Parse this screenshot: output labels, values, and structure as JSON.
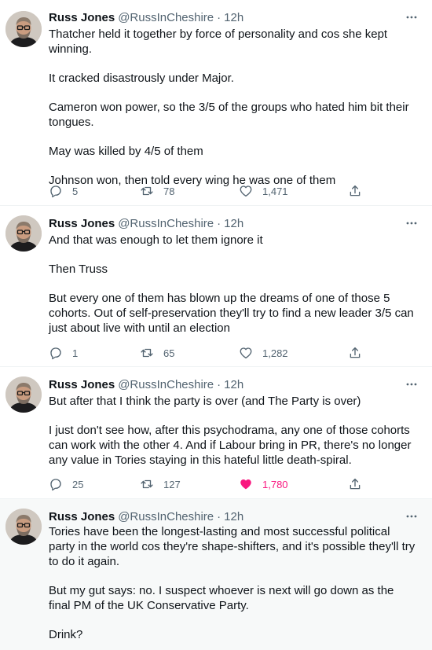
{
  "colors": {
    "like_active": "#f91880",
    "secondary_text": "#536471",
    "divider": "#eff3f4",
    "highlight_bg": "#f7f9f9"
  },
  "icons": [
    "more-icon",
    "reply-icon",
    "retweet-icon",
    "like-icon",
    "share-icon"
  ],
  "tweets": [
    {
      "author": "Russ Jones",
      "handle": "@RussInCheshire",
      "separator": "·",
      "time": "12h",
      "paragraphs": [
        "Thatcher held it together by force of personality and cos she kept winning.",
        "It cracked disastrously under Major.",
        "Cameron won power, so the 3/5 of the groups who hated him bit their tongues.",
        "May was killed by 4/5 of them",
        "Johnson won, then told every wing he was one of them"
      ],
      "replies": "5",
      "retweets": "78",
      "likes": "1,471",
      "liked": false
    },
    {
      "author": "Russ Jones",
      "handle": "@RussInCheshire",
      "separator": "·",
      "time": "12h",
      "paragraphs": [
        "And that was enough to let them ignore it",
        "Then Truss",
        "But every one of them has blown up the dreams of one of those 5 cohorts. Out of self-preservation they'll try to find a new leader 3/5 can just about live with until an election"
      ],
      "replies": "1",
      "retweets": "65",
      "likes": "1,282",
      "liked": false
    },
    {
      "author": "Russ Jones",
      "handle": "@RussInCheshire",
      "separator": "·",
      "time": "12h",
      "paragraphs": [
        "But after that I think the party is over (and The Party is over)",
        "I just don't see how, after this psychodrama, any one of those cohorts can work with the other 4. And if Labour bring in PR, there's no longer any value in Tories staying in this hateful little death-spiral."
      ],
      "replies": "25",
      "retweets": "127",
      "likes": "1,780",
      "liked": true
    },
    {
      "author": "Russ Jones",
      "handle": "@RussInCheshire",
      "separator": "·",
      "time": "12h",
      "paragraphs": [
        "Tories have been the longest-lasting and most successful political party in the world cos they're shape-shifters, and it's possible they'll try to do it again.",
        "But my gut says: no. I suspect whoever is next will go down as the final PM of the UK Conservative Party.",
        "Drink?"
      ]
    }
  ]
}
